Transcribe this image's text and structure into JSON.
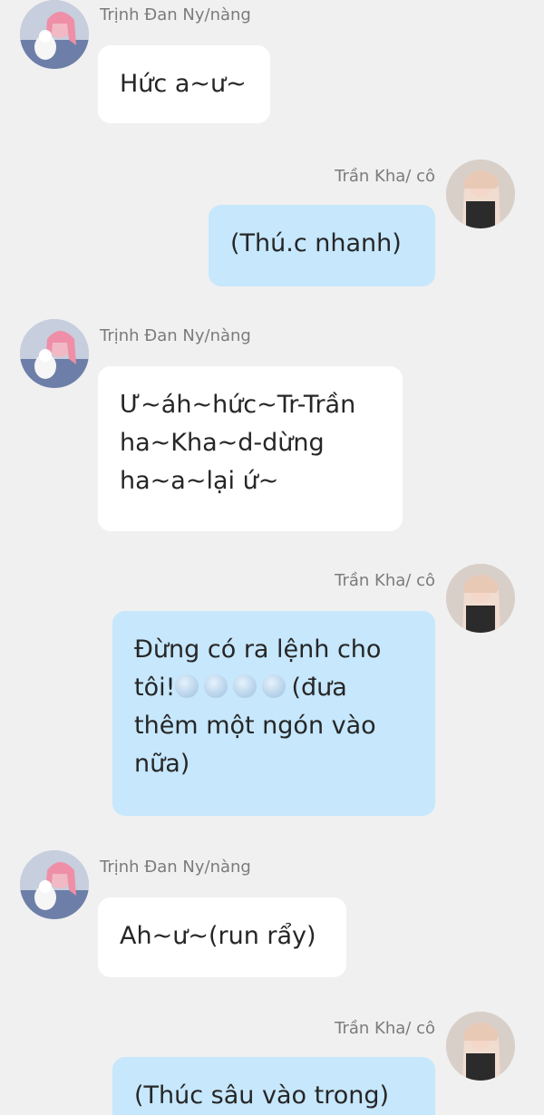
{
  "conversation": {
    "messages": [
      {
        "sender": "Trịnh Đan Ny/nàng",
        "side": "left",
        "lines": [
          "Hức a~ư~"
        ]
      },
      {
        "sender": "Trần Kha/ cô",
        "side": "right",
        "lines": [
          "(Thú.c nhanh)"
        ]
      },
      {
        "sender": "Trịnh Đan Ny/nàng",
        "side": "left",
        "lines": [
          "Ư~áh~hức~Tr-Trần",
          "ha~Kha~d-dừng",
          "ha~a~lại ứ~"
        ]
      },
      {
        "sender": "Trần Kha/ cô",
        "side": "right",
        "lines": [
          "Đừng có ra lệnh cho",
          "tôi!",
          "(đưa",
          "thêm một ngón vào",
          "nữa)"
        ]
      },
      {
        "sender": "Trịnh Đan Ny/nàng",
        "side": "left",
        "lines": [
          "Ah~ư~(run rẩy)"
        ]
      },
      {
        "sender": "Trần Kha/ cô",
        "side": "right",
        "lines": [
          "(Thúc sâu vào trong)"
        ]
      }
    ]
  },
  "emoji": {
    "name": "smiling-face-emoji",
    "count": 4
  },
  "avatars": {
    "left_icon": "avatar-pink-hair-girl",
    "right_icon": "avatar-light-hair-girl"
  },
  "colors": {
    "background": "#f0f0f0",
    "bubble_left": "#ffffff",
    "bubble_right": "#c6e7fc",
    "sender_text": "#7b7b7b",
    "message_text": "#262626"
  }
}
